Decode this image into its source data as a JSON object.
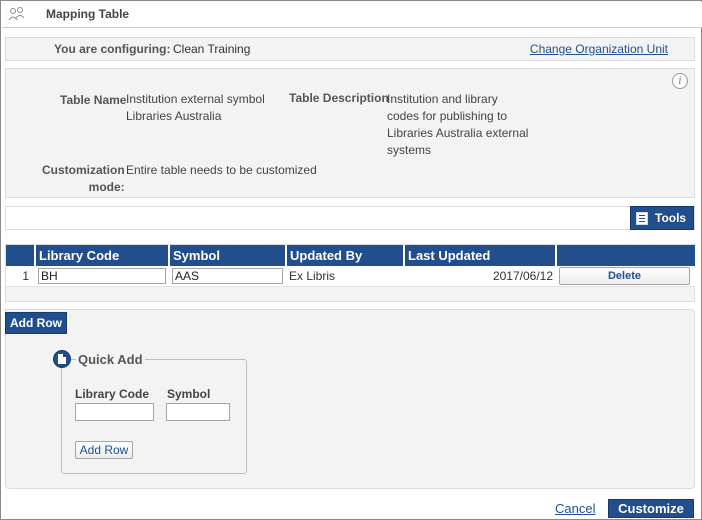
{
  "window": {
    "title": "Mapping Table"
  },
  "config_bar": {
    "label": "You are configuring:",
    "value": "Clean Training",
    "change_link": "Change Organization Unit"
  },
  "details": {
    "table_name_label": "Table Name",
    "table_name_line1": "Institution external symbol",
    "table_name_line2": "Libraries Australia",
    "table_desc_label": "Table Description",
    "table_desc_line1": "Institution and library",
    "table_desc_line2": "codes for publishing to",
    "table_desc_line3": "Libraries Australia external",
    "table_desc_line4": "systems",
    "mode_label_line1": "Customization",
    "mode_label_line2": "mode:",
    "mode_value": "Entire table needs to be customized"
  },
  "toolbar": {
    "tools_label": "Tools"
  },
  "table": {
    "columns": [
      "",
      "Library Code",
      "Symbol",
      "Updated By",
      "Last Updated",
      ""
    ],
    "rows": [
      {
        "index": "1",
        "library_code": "BH",
        "symbol": "AAS",
        "updated_by": "Ex Libris",
        "last_updated": "2017/06/12",
        "action": "Delete"
      }
    ]
  },
  "add_row": {
    "label": "Add Row"
  },
  "quick_add": {
    "title": "Quick Add",
    "library_code_label": "Library Code",
    "symbol_label": "Symbol",
    "library_code_value": "",
    "symbol_value": "",
    "add_button": "Add Row"
  },
  "footer": {
    "cancel": "Cancel",
    "customize": "Customize"
  },
  "colors": {
    "accent": "#224e8d",
    "panel": "#f3f3f3",
    "link": "#1f4f94"
  }
}
